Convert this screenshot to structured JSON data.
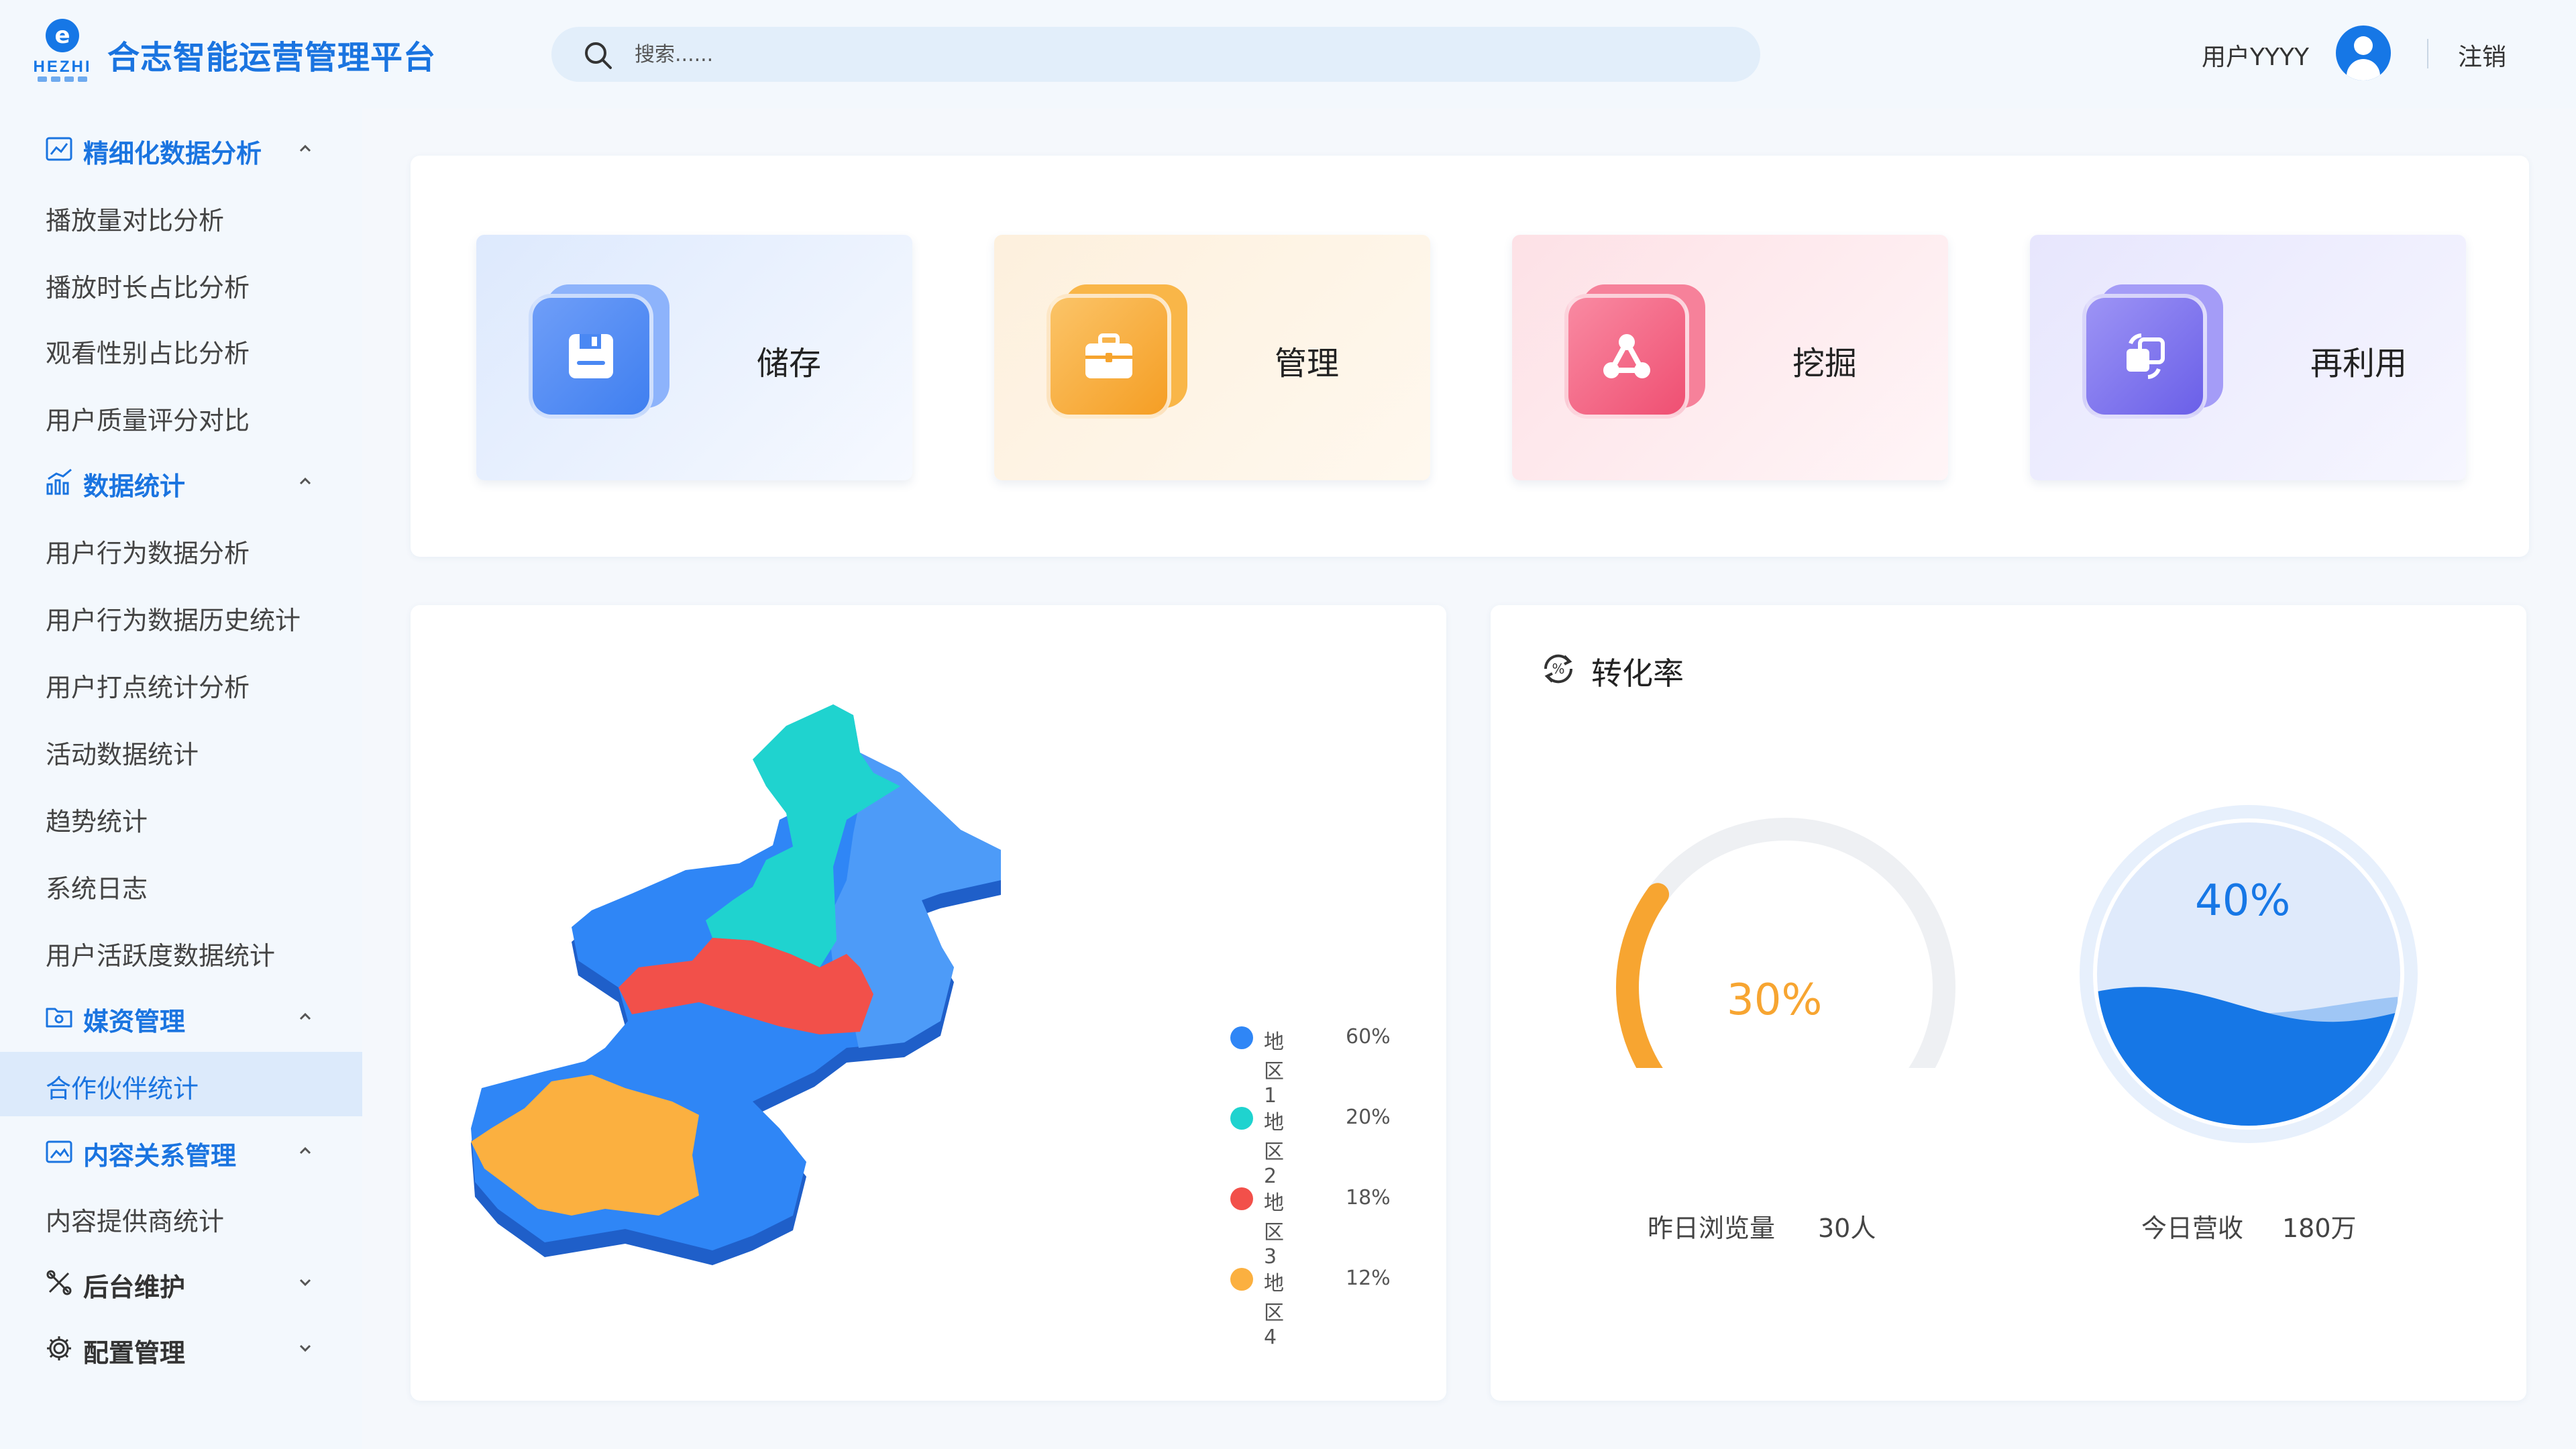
{
  "app": {
    "title": "合志智能运营管理平台",
    "logo_text": "HEZHI",
    "logo_glyph": "e",
    "brand_color": "#1677e6"
  },
  "search": {
    "placeholder": "搜索......",
    "icon": "search-icon"
  },
  "user": {
    "name": "用户YYYY",
    "logout_label": "注销"
  },
  "sidebar": {
    "groups": [
      {
        "label": "精细化数据分析",
        "icon": "trend-chart-icon",
        "expanded": true
      },
      {
        "label": "数据统计",
        "icon": "bar-line-chart-icon",
        "expanded": true
      },
      {
        "label": "媒资管理",
        "icon": "folder-icon",
        "expanded": true
      },
      {
        "label": "内容关系管理",
        "icon": "image-folder-icon",
        "expanded": true
      },
      {
        "label": "后台维护",
        "icon": "tools-icon",
        "expanded": false
      },
      {
        "label": "配置管理",
        "icon": "gear-icon",
        "expanded": false
      }
    ],
    "items": {
      "analysis": [
        "播放量对比分析",
        "播放时长占比分析",
        "观看性别占比分析",
        "用户质量评分对比"
      ],
      "stats": [
        "用户行为数据分析",
        "用户行为数据历史统计",
        "用户打点统计分析",
        "活动数据统计",
        "趋势统计",
        "系统日志",
        "用户活跃度数据统计"
      ],
      "media": [
        "合作伙伴统计"
      ],
      "content": [
        "内容提供商统计"
      ]
    },
    "active_item": "合作伙伴统计"
  },
  "features": [
    {
      "label": "储存",
      "icon": "floppy-disk-icon",
      "color": "#4d8ff5"
    },
    {
      "label": "管理",
      "icon": "toolbox-icon",
      "color": "#f7a531"
    },
    {
      "label": "挖掘",
      "icon": "share-nodes-icon",
      "color": "#f2577a"
    },
    {
      "label": "再利用",
      "icon": "recycle-icon",
      "color": "#7c72f0"
    }
  ],
  "map": {
    "regions": [
      {
        "name": "地区1",
        "percent": "60%",
        "color": "#2f86f6"
      },
      {
        "name": "地区2",
        "percent": "20%",
        "color": "#1fd3cf"
      },
      {
        "name": "地区3",
        "percent": "18%",
        "color": "#f2504a"
      },
      {
        "name": "地区4",
        "percent": "12%",
        "color": "#fbb040"
      }
    ]
  },
  "conversion": {
    "title": "转化率",
    "icon": "percent-cycle-icon",
    "gauge": {
      "value": 0.3,
      "display": "30%",
      "label": "昨日浏览量",
      "amount": "30人",
      "color": "#f7a531"
    },
    "wave": {
      "value": 0.4,
      "display": "40%",
      "label": "今日营收",
      "amount": "180万",
      "color": "#1677e6"
    }
  }
}
